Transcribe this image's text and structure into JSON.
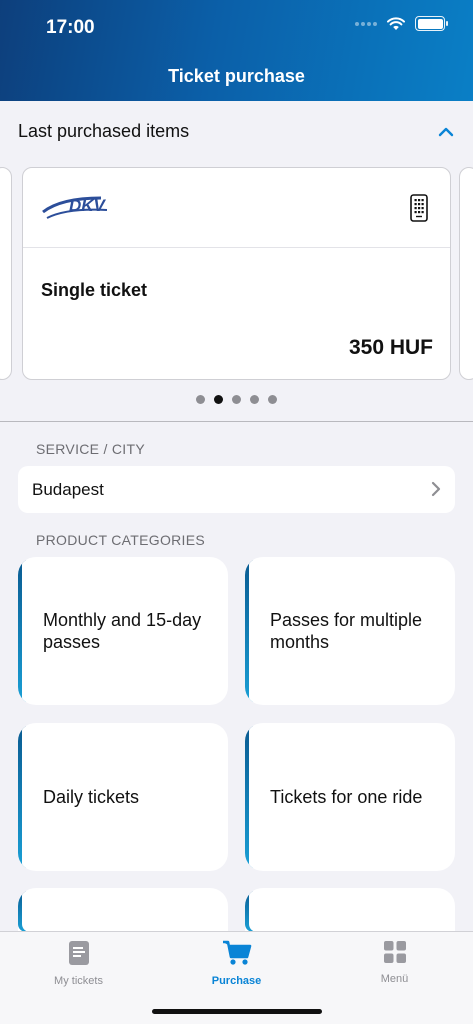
{
  "status_bar": {
    "time": "17:00"
  },
  "header": {
    "title": "Ticket purchase"
  },
  "last_purchased": {
    "title": "Last purchased items",
    "card": {
      "operator": "DKV",
      "name": "Single ticket",
      "price": "350 HUF"
    },
    "pager": {
      "count": 5,
      "active_index": 1
    }
  },
  "service": {
    "label": "SERVICE / CITY",
    "city": "Budapest"
  },
  "categories": {
    "label": "PRODUCT CATEGORIES",
    "items": [
      {
        "label": "Monthly and 15-day passes"
      },
      {
        "label": "Passes for multiple months"
      },
      {
        "label": "Daily tickets"
      },
      {
        "label": "Tickets for one ride"
      }
    ]
  },
  "tabbar": {
    "items": [
      {
        "label": "My tickets",
        "icon": "document-icon"
      },
      {
        "label": "Purchase",
        "icon": "cart-icon"
      },
      {
        "label": "Menü",
        "icon": "grid-icon"
      }
    ],
    "active_index": 1
  },
  "colors": {
    "accent": "#0a84d6",
    "header_start": "#0d3f7c",
    "header_end": "#0a7fc6"
  }
}
